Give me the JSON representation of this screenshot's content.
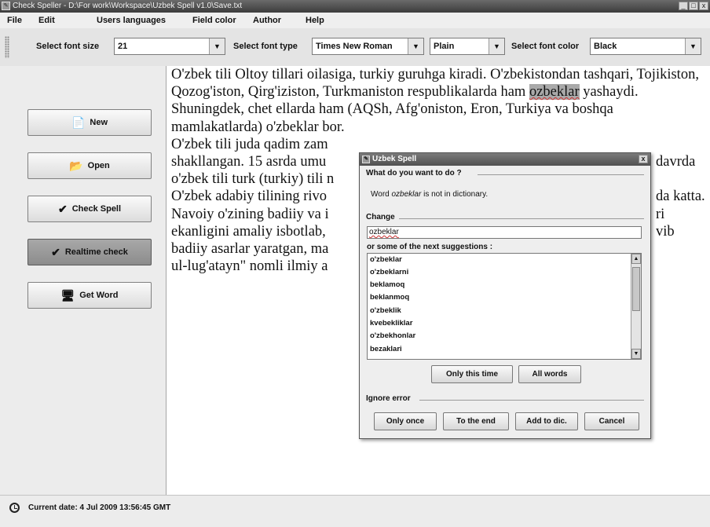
{
  "window": {
    "title": "Check Speller - D:\\For work\\Workspace\\Uzbek Spell v1.0\\Save.txt",
    "controls": [
      "_",
      "□",
      "x"
    ]
  },
  "menu": [
    "File",
    "Edit",
    "Users languages",
    "Field color",
    "Author",
    "Help"
  ],
  "toolbar": {
    "font_size_label": "Select font size",
    "font_size_value": "21",
    "font_type_label": "Select font type",
    "font_type_value": "Times New Roman",
    "style_value": "Plain",
    "font_color_label": "Select font color",
    "font_color_value": "Black"
  },
  "sidebar": {
    "buttons": [
      "New",
      "Open",
      "Check Spell",
      "Realtime check",
      "Get Word"
    ]
  },
  "editor": {
    "para1_before": "O'zbek tili Oltoy tillari oilasiga, turkiy guruhga kiradi. O'zbekistondan tashqari, Tojikiston, Qozog'iston, Qirg'iziston, Turkmaniston respublikalarda ham ",
    "para1_highlight": "ozbeklar",
    "para1_after": " yashaydi. Shuningdek, chet ellarda ham (AQSh, Afg'oniston, Eron, Turkiya va boshqa mamlakatlarda) o'zbeklar bor.",
    "line6": "O'zbek tili juda qadim zam",
    "line7_left": "shakllangan. 15 asrda umu",
    "line7_right": "davrda",
    "line8": "o'zbek tili turk (turkiy) tili n",
    "line9_left": "O'zbek adabiy tilining rivo",
    "line9_right": "da katta.",
    "line10_left": "Navoiy o'zining badiiy va i",
    "line10_right": "ri",
    "line11_left": "ekanligini amaliy isbotlab,",
    "line11_right": "vib",
    "line12": "badiiy asarlar yaratgan, ma",
    "line13": "ul-lug'atayn\" nomli ilmiy a"
  },
  "status": {
    "text": "Current date: 4 Jul 2009 13:56:45 GMT"
  },
  "dialog": {
    "title": "Uzbek Spell",
    "close": "x",
    "group1_label": "What do you want to do ?",
    "msg_before": "Word ",
    "msg_word": "ozbeklar",
    "msg_after": " is not in dictionary.",
    "change_label": "Change",
    "change_value": "ozbeklar",
    "suggestions_label": "or some of the next suggestions :",
    "suggestions": [
      "o'zbeklar",
      "o'zbeklarni",
      "beklamoq",
      "beklanmoq",
      "o'zbeklik",
      "kvebekliklar",
      "o'zbekhonlar",
      "bezaklari"
    ],
    "only_this_time": "Only this time",
    "all_words": "All words",
    "ignore_label": "Ignore error",
    "only_once": "Only once",
    "to_the_end": "To the end",
    "add_to_dic": "Add to dic.",
    "cancel": "Cancel"
  }
}
